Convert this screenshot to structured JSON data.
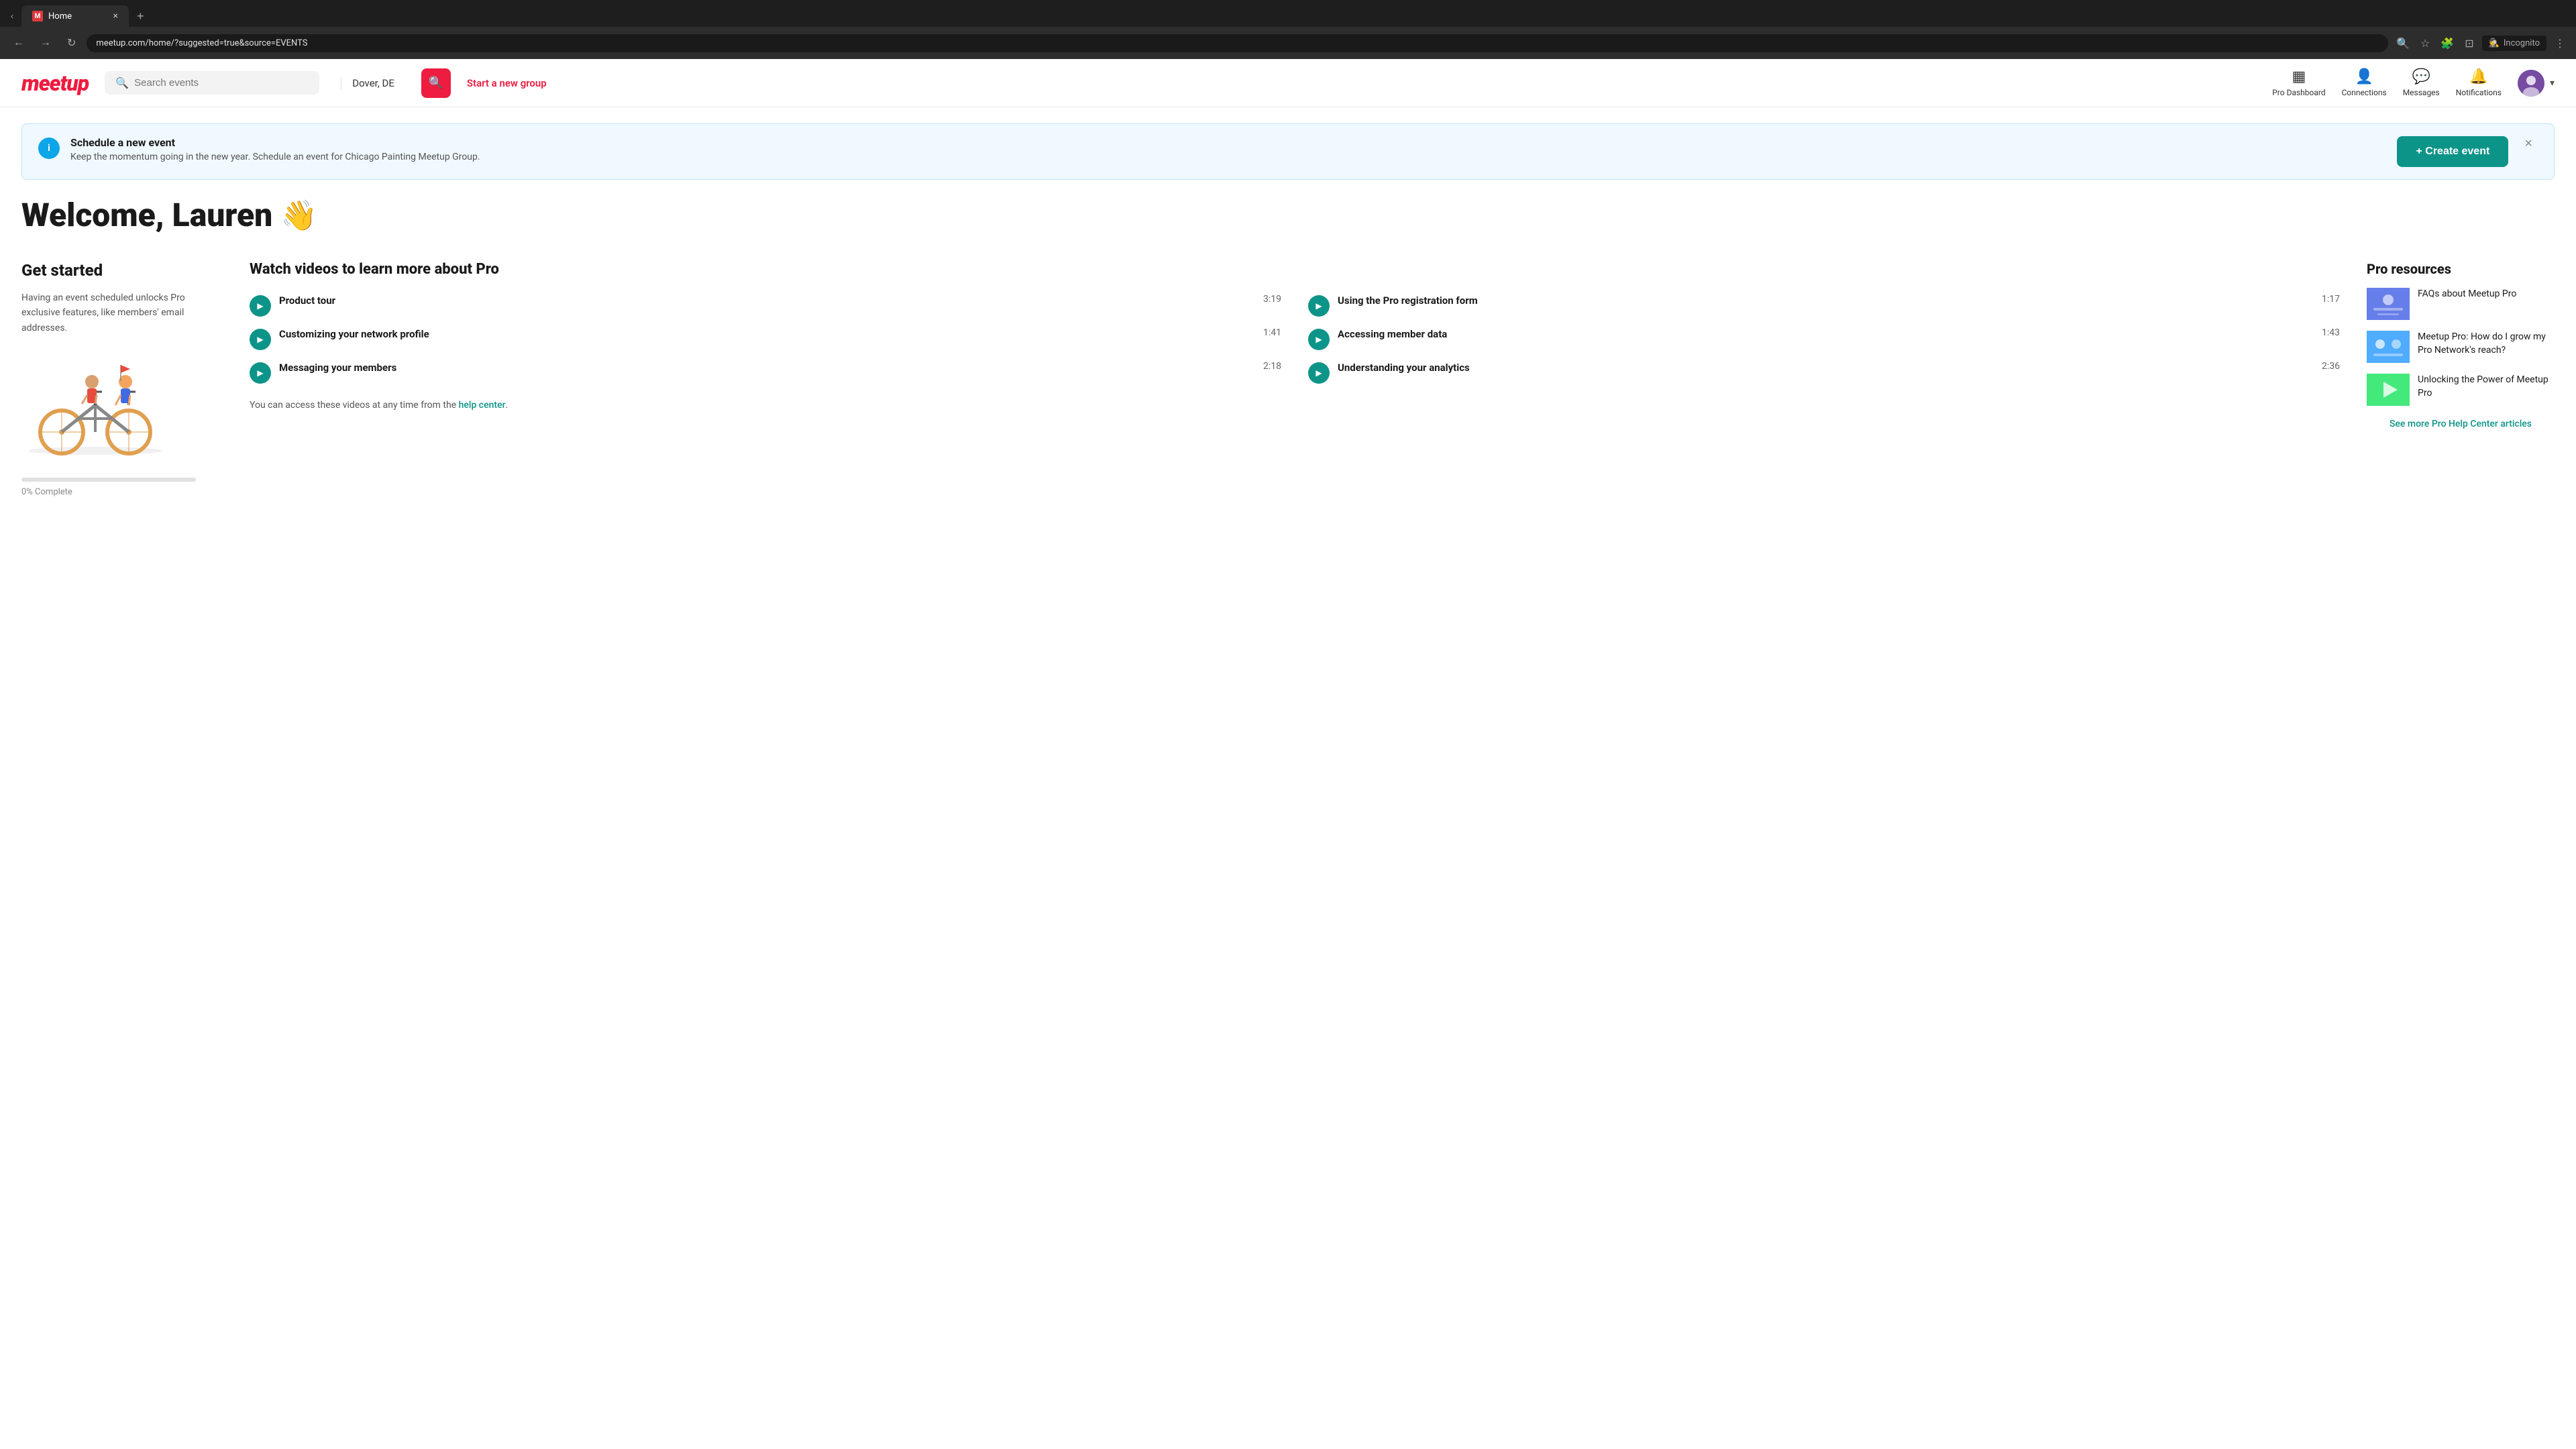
{
  "browser": {
    "tab_arrow": "›",
    "tab_favicon": "M",
    "tab_title": "Home",
    "tab_close": "×",
    "new_tab": "+",
    "nav_back": "←",
    "nav_forward": "→",
    "nav_refresh": "↻",
    "url": "meetup.com/home/?suggested=true&source=EVENTS",
    "search_icon": "🔍",
    "star_icon": "☆",
    "extensions_icon": "🧩",
    "profile_icon": "⊡",
    "incognito_label": "Incognito",
    "menu_icon": "⋮"
  },
  "header": {
    "logo": "meetup",
    "search_placeholder": "Search events",
    "location": "Dover, DE",
    "search_btn_icon": "🔍",
    "start_group": "Start a new group",
    "nav": {
      "pro_dashboard_label": "Pro Dashboard",
      "connections_label": "Connections",
      "messages_label": "Messages",
      "notifications_label": "Notifications"
    }
  },
  "banner": {
    "icon": "i",
    "title": "Schedule a new event",
    "desc": "Keep the momentum going in the new year. Schedule an event for Chicago Painting Meetup Group.",
    "create_btn": "+ Create event",
    "close": "×"
  },
  "main": {
    "welcome_text": "Welcome, Lauren",
    "wave_emoji": "👋",
    "get_started": {
      "title": "Get started",
      "desc": "Having an event scheduled unlocks Pro exclusive features, like members' email addresses.",
      "progress_pct": 0,
      "progress_label": "0% Complete"
    },
    "videos": {
      "heading": "Watch videos to learn more about Pro",
      "items": [
        {
          "title": "Product tour",
          "duration": "3:19"
        },
        {
          "title": "Using the Pro registration form",
          "duration": "1:17"
        },
        {
          "title": "Customizing your network profile",
          "duration": "1:41"
        },
        {
          "title": "Accessing member data",
          "duration": "1:43"
        },
        {
          "title": "Messaging your members",
          "duration": "2:18"
        },
        {
          "title": "Understanding your analytics",
          "duration": "2:36"
        }
      ],
      "help_text": "You can access these videos at any time from the",
      "help_link_text": "help center",
      "help_link_suffix": "."
    },
    "pro_resources": {
      "title": "Pro resources",
      "items": [
        {
          "title": "FAQs about Meetup Pro"
        },
        {
          "title": "Meetup Pro: How do I grow my Pro Network's reach?"
        },
        {
          "title": "Unlocking the Power of Meetup Pro"
        }
      ],
      "see_more_label": "See more Pro Help Center articles"
    }
  }
}
